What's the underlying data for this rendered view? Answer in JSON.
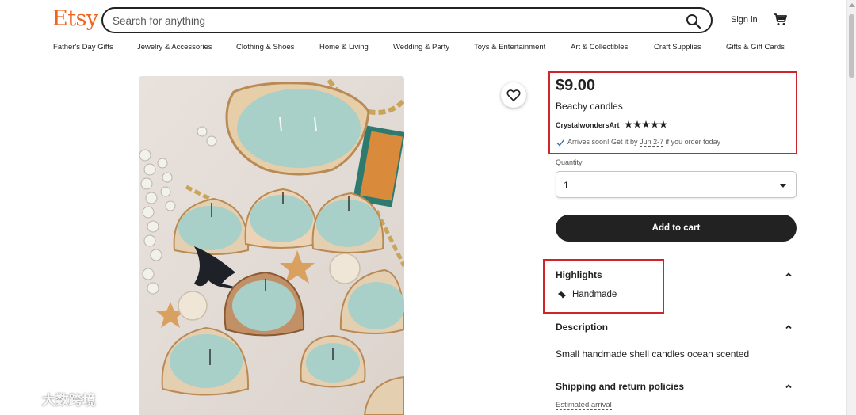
{
  "header": {
    "logo": "Etsy",
    "search": {
      "placeholder": "Search for anything",
      "value": ""
    },
    "signin_label": "Sign in",
    "nav": [
      "Father's Day Gifts",
      "Jewelry & Accessories",
      "Clothing & Shoes",
      "Home & Living",
      "Wedding & Party",
      "Toys & Entertainment",
      "Art & Collectibles",
      "Craft Supplies",
      "Gifts & Gift Cards"
    ]
  },
  "listing": {
    "price": "$9.00",
    "title": "Beachy candles",
    "shop_name": "CrystalwondersArt",
    "rating_stars": 5,
    "arrival": {
      "prefix": "Arrives soon! Get it by",
      "dates": "Jun 2-7",
      "suffix": "if you order today"
    },
    "quantity": {
      "label": "Quantity",
      "value": "1"
    },
    "add_to_cart_label": "Add to cart",
    "highlights": {
      "heading": "Highlights",
      "items": [
        "Handmade"
      ]
    },
    "description": {
      "heading": "Description",
      "text": "Small handmade shell candles ocean scented"
    },
    "shipping": {
      "heading": "Shipping and return policies",
      "estimated_arrival_label": "Estimated arrival"
    }
  },
  "watermark": {
    "text": "大数跨境"
  },
  "colors": {
    "brand": "#f1641e",
    "highlight_box": "#d1232a",
    "button": "#222222"
  }
}
